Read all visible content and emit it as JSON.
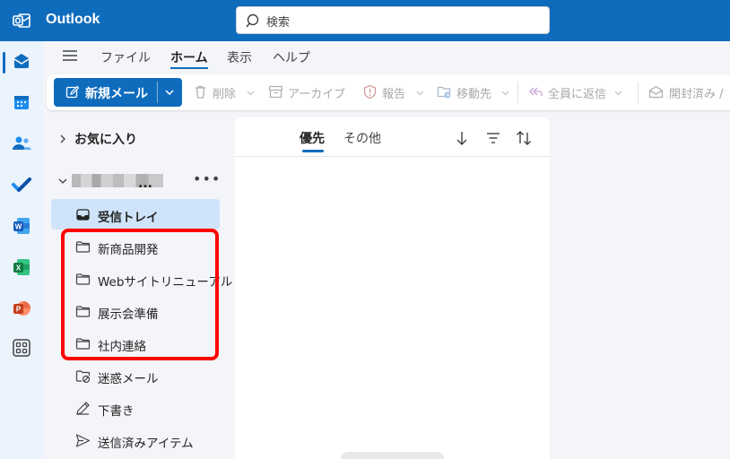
{
  "app": {
    "name": "Outlook",
    "brand_color": "#0f6cbd"
  },
  "search": {
    "placeholder": "検索"
  },
  "rail": {
    "items": [
      "mail-icon",
      "calendar-icon",
      "people-icon",
      "todo-icon",
      "word-icon",
      "excel-icon",
      "powerpoint-icon",
      "more-apps-icon"
    ],
    "active": "mail-icon"
  },
  "menu_tabs": [
    {
      "label": "ファイル",
      "active": false
    },
    {
      "label": "ホーム",
      "active": true
    },
    {
      "label": "表示",
      "active": false
    },
    {
      "label": "ヘルプ",
      "active": false
    }
  ],
  "ribbon": {
    "new_mail": "新規メール",
    "delete": "削除",
    "archive": "アーカイブ",
    "report": "報告",
    "move_to": "移動先",
    "reply_all": "全員に返信",
    "read_unread": "開封済み /"
  },
  "folder_pane": {
    "favorites": "お気に入り",
    "account_suffix": "...",
    "folders": [
      {
        "label": "受信トレイ",
        "icon": "inbox-icon",
        "selected": true
      },
      {
        "label": "新商品開発",
        "icon": "folder-icon",
        "selected": false
      },
      {
        "label": "Webサイトリニューアル",
        "icon": "folder-icon",
        "selected": false
      },
      {
        "label": "展示会準備",
        "icon": "folder-icon",
        "selected": false
      },
      {
        "label": "社内連絡",
        "icon": "folder-icon",
        "selected": false
      },
      {
        "label": "迷惑メール",
        "icon": "junk-folder-icon",
        "selected": false
      },
      {
        "label": "下書き",
        "icon": "draft-pencil-icon",
        "selected": false
      },
      {
        "label": "送信済みアイテム",
        "icon": "sent-icon",
        "selected": false
      }
    ],
    "highlight_color": "#ff0000"
  },
  "message_list": {
    "tabs": [
      {
        "label": "優先",
        "active": true
      },
      {
        "label": "その他",
        "active": false
      }
    ]
  }
}
